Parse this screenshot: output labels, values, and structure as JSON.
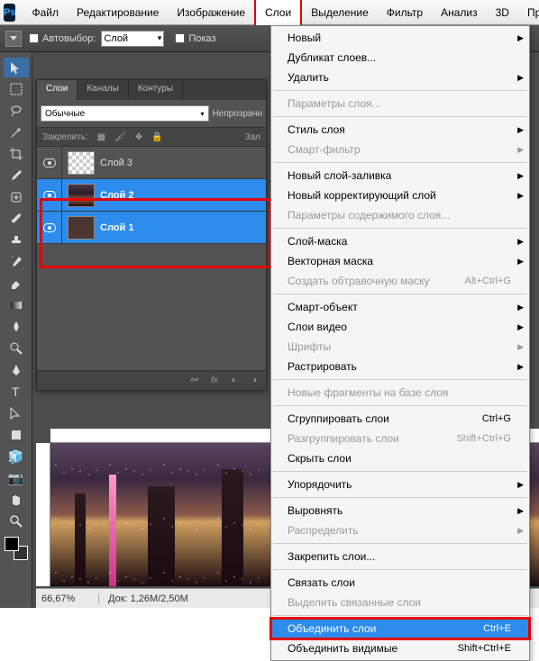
{
  "app": {
    "logo": "Ps"
  },
  "menubar": {
    "items": [
      "Файл",
      "Редактирование",
      "Изображение",
      "Слои",
      "Выделение",
      "Фильтр",
      "Анализ",
      "3D",
      "Про"
    ],
    "activeIndex": 3
  },
  "optionsBar": {
    "autoselect_label": "Автовыбор:",
    "autoselect_value": "Слой",
    "show_label": "Показ"
  },
  "layersPanel": {
    "tabs": [
      "Слои",
      "Каналы",
      "Контуры"
    ],
    "activeTab": 0,
    "blendMode": "Обычные",
    "opacity_label": "Непрозрачн",
    "lock_label": "Закрепить:",
    "fill_label": "Зал",
    "layers": [
      {
        "name": "Слой 3",
        "selected": false,
        "thumb": "checker"
      },
      {
        "name": "Слой 2",
        "selected": true,
        "thumb": "city"
      },
      {
        "name": "Слой 1",
        "selected": true,
        "thumb": "brown"
      }
    ]
  },
  "statusBar": {
    "zoom": "66,67%",
    "docsize": "Док: 1,26M/2,50M"
  },
  "dropdown": {
    "groups": [
      [
        {
          "label": "Новый",
          "sub": true
        },
        {
          "label": "Дубликат слоев...",
          "sub": false
        },
        {
          "label": "Удалить",
          "sub": true
        }
      ],
      [
        {
          "label": "Параметры слоя...",
          "disabled": true
        }
      ],
      [
        {
          "label": "Стиль слоя",
          "sub": true
        },
        {
          "label": "Смарт-фильтр",
          "sub": true,
          "disabled": true
        }
      ],
      [
        {
          "label": "Новый слой-заливка",
          "sub": true
        },
        {
          "label": "Новый корректирующий слой",
          "sub": true
        },
        {
          "label": "Параметры содержимого слоя...",
          "disabled": true
        }
      ],
      [
        {
          "label": "Слой-маска",
          "sub": true
        },
        {
          "label": "Векторная маска",
          "sub": true
        },
        {
          "label": "Создать обтравочную маску",
          "shortcut": "Alt+Ctrl+G",
          "disabled": true
        }
      ],
      [
        {
          "label": "Смарт-объект",
          "sub": true
        },
        {
          "label": "Слои видео",
          "sub": true
        },
        {
          "label": "Шрифты",
          "sub": true,
          "disabled": true
        },
        {
          "label": "Растрировать",
          "sub": true
        }
      ],
      [
        {
          "label": "Новые фрагменты на базе слоя",
          "disabled": true
        }
      ],
      [
        {
          "label": "Сгруппировать слои",
          "shortcut": "Ctrl+G"
        },
        {
          "label": "Разгруппировать слои",
          "shortcut": "Shift+Ctrl+G",
          "disabled": true
        },
        {
          "label": "Скрыть слои"
        }
      ],
      [
        {
          "label": "Упорядочить",
          "sub": true
        }
      ],
      [
        {
          "label": "Выровнять",
          "sub": true
        },
        {
          "label": "Распределить",
          "sub": true,
          "disabled": true
        }
      ],
      [
        {
          "label": "Закрепить слои..."
        }
      ],
      [
        {
          "label": "Связать слои"
        },
        {
          "label": "Выделить связанные слои",
          "disabled": true
        }
      ],
      [
        {
          "label": "Объединить слои",
          "shortcut": "Ctrl+E",
          "highlighted": true
        },
        {
          "label": "Объединить видимые",
          "shortcut": "Shift+Ctrl+E"
        }
      ]
    ]
  }
}
